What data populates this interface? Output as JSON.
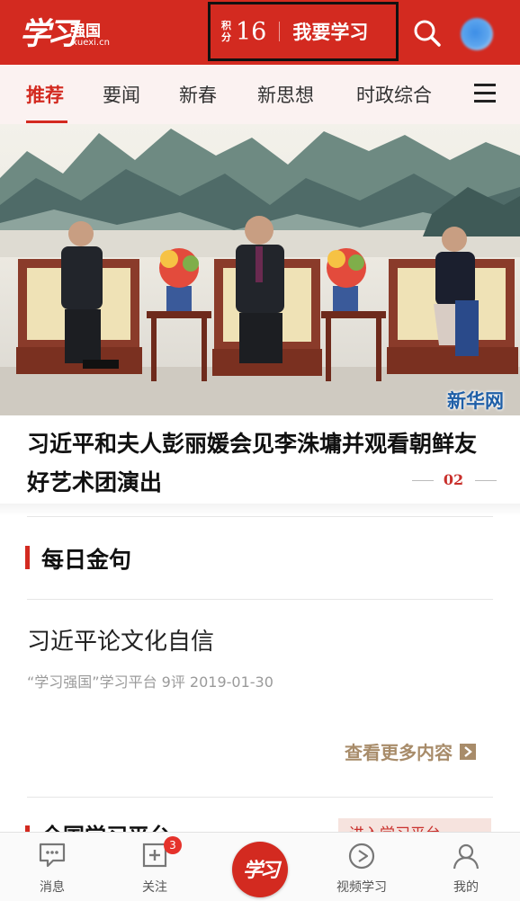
{
  "header": {
    "logo_script": "学习",
    "logo_name": "强国",
    "logo_domain": "xuexi.cn",
    "score_label": "积分",
    "score_value": "16",
    "study_button": "我要学习",
    "search_icon": "search-icon",
    "avatar": "user-avatar",
    "colors": {
      "brand_red": "#d32a20"
    }
  },
  "tabs": {
    "items": [
      "推荐",
      "要闻",
      "新春",
      "新思想",
      "时政综合"
    ],
    "active": "推荐",
    "menu_icon": "hamburger-menu-icon"
  },
  "hero": {
    "watermark": "新华网"
  },
  "headline": {
    "title": "习近平和夫人彭丽媛会见李洙墉并观看朝鲜友好艺术团演出",
    "page_number": "02"
  },
  "daily_quote": {
    "section_title": "每日金句",
    "article_title": "习近平论文化自信",
    "article_meta": "“学习强国”学习平台  9评  2019-01-30",
    "more_link": "查看更多内容"
  },
  "next_section": {
    "title": "全国学习平台",
    "tag": "进入学习平台"
  },
  "bottom_nav": {
    "items": [
      {
        "label": "消息",
        "icon": "message-icon"
      },
      {
        "label": "关注",
        "icon": "follow-icon",
        "badge": "3"
      },
      {
        "label": "学习",
        "icon": "study-center-icon"
      },
      {
        "label": "视频学习",
        "icon": "video-play-icon"
      },
      {
        "label": "我的",
        "icon": "profile-icon"
      }
    ],
    "center_text": "学习"
  }
}
